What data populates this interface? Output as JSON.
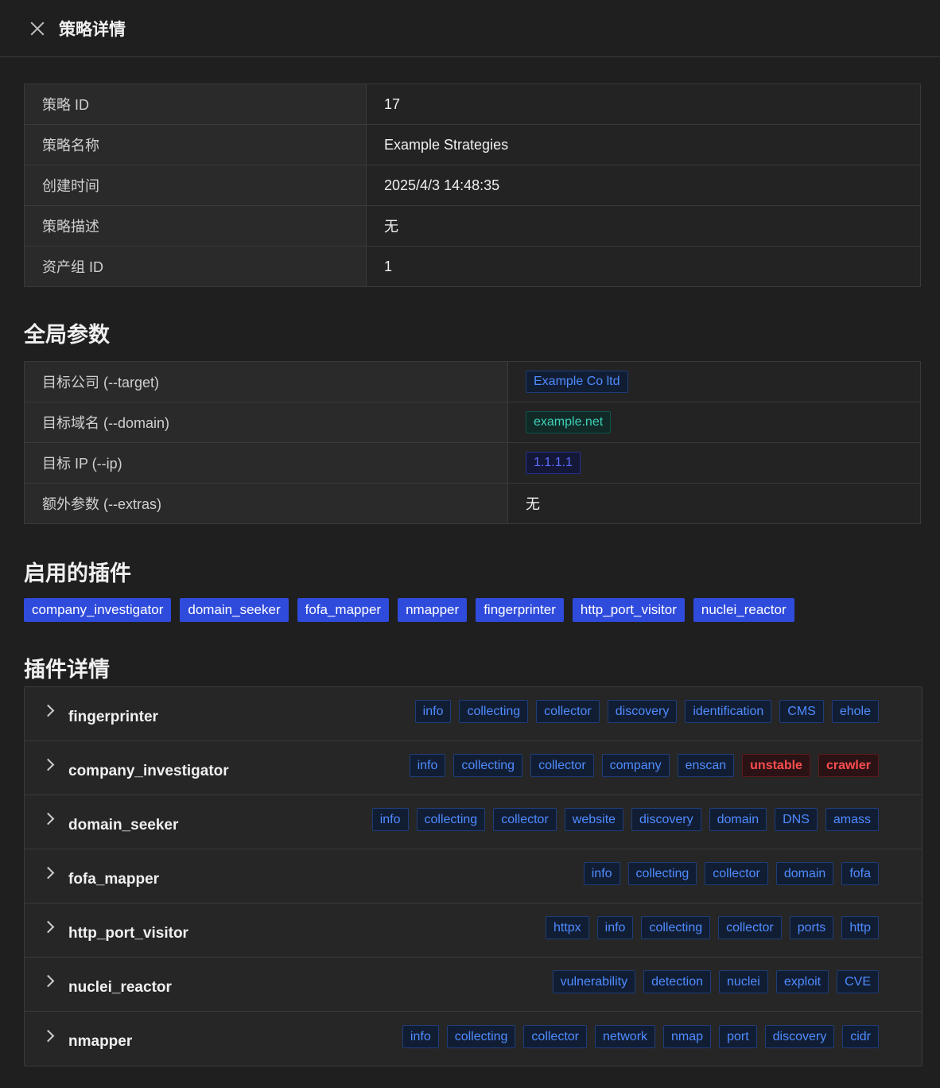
{
  "header": {
    "title": "策略详情"
  },
  "info": [
    {
      "k": "策略 ID",
      "v": "17"
    },
    {
      "k": "策略名称",
      "v": "Example Strategies"
    },
    {
      "k": "创建时间",
      "v": "2025/4/3 14:48:35"
    },
    {
      "k": "策略描述",
      "v": "无"
    },
    {
      "k": "资产组 ID",
      "v": "1"
    }
  ],
  "global": {
    "title": "全局参数",
    "rows": [
      {
        "k": "目标公司 (--target)",
        "v": "Example Co ltd",
        "style": "blue"
      },
      {
        "k": "目标域名 (--domain)",
        "v": "example.net",
        "style": "green"
      },
      {
        "k": "目标 IP (--ip)",
        "v": "1.1.1.1",
        "style": "geek"
      },
      {
        "k": "额外参数 (--extras)",
        "v": "无",
        "style": "text"
      }
    ]
  },
  "enabled": {
    "title": "启用的插件",
    "items": [
      "company_investigator",
      "domain_seeker",
      "fofa_mapper",
      "nmapper",
      "fingerprinter",
      "http_port_visitor",
      "nuclei_reactor"
    ]
  },
  "details": {
    "title": "插件详情",
    "plugins": [
      {
        "name": "fingerprinter",
        "tags": [
          "info",
          "collecting",
          "collector",
          "discovery",
          "identification",
          "CMS",
          "ehole"
        ],
        "red": []
      },
      {
        "name": "company_investigator",
        "tags": [
          "info",
          "collecting",
          "collector",
          "company",
          "enscan",
          "unstable",
          "crawler"
        ],
        "red": [
          "unstable",
          "crawler"
        ]
      },
      {
        "name": "domain_seeker",
        "tags": [
          "info",
          "collecting",
          "collector",
          "website",
          "discovery",
          "domain",
          "DNS",
          "amass"
        ],
        "red": []
      },
      {
        "name": "fofa_mapper",
        "tags": [
          "info",
          "collecting",
          "collector",
          "domain",
          "fofa"
        ],
        "red": []
      },
      {
        "name": "http_port_visitor",
        "tags": [
          "httpx",
          "info",
          "collecting",
          "collector",
          "ports",
          "http"
        ],
        "red": []
      },
      {
        "name": "nuclei_reactor",
        "tags": [
          "vulnerability",
          "detection",
          "nuclei",
          "exploit",
          "CVE"
        ],
        "red": []
      },
      {
        "name": "nmapper",
        "tags": [
          "info",
          "collecting",
          "collector",
          "network",
          "nmap",
          "port",
          "discovery",
          "cidr"
        ],
        "red": []
      }
    ]
  },
  "colors": {
    "tag_blue": "#4f8bff",
    "tag_green": "#3fd0b8",
    "tag_red": "#ff4d4f",
    "plugin_bg": "#2f4bdc"
  }
}
